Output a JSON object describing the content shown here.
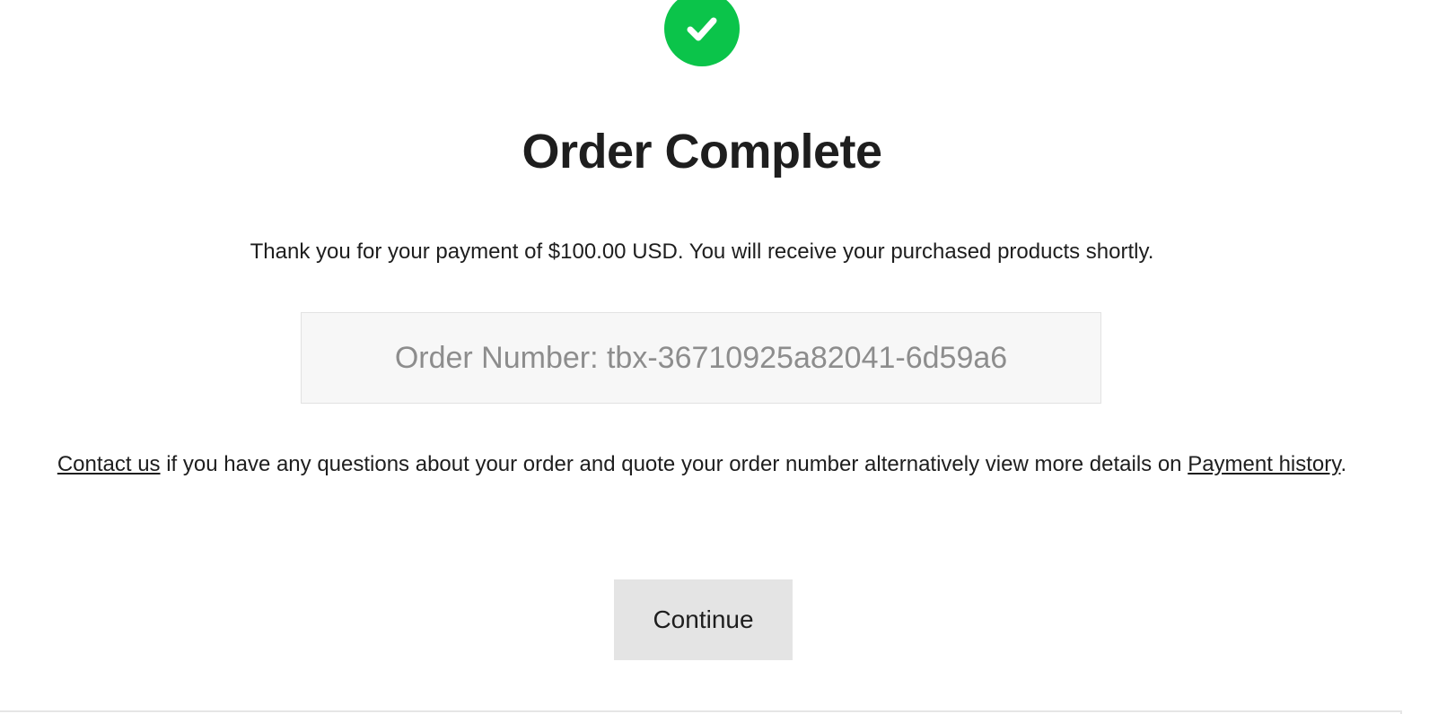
{
  "status_icon": {
    "name": "checkmark-icon",
    "color": "#0bc44a"
  },
  "title": "Order Complete",
  "message": "Thank you for your payment of $100.00 USD. You will receive your purchased products shortly.",
  "order_number": "Order Number: tbx-36710925a82041-6d59a6",
  "contact": {
    "link_contact": "Contact us",
    "text_middle": " if you have any questions about your order and quote your order number alternatively view more details on ",
    "link_payment_history": "Payment history",
    "text_end": "."
  },
  "continue_label": "Continue"
}
